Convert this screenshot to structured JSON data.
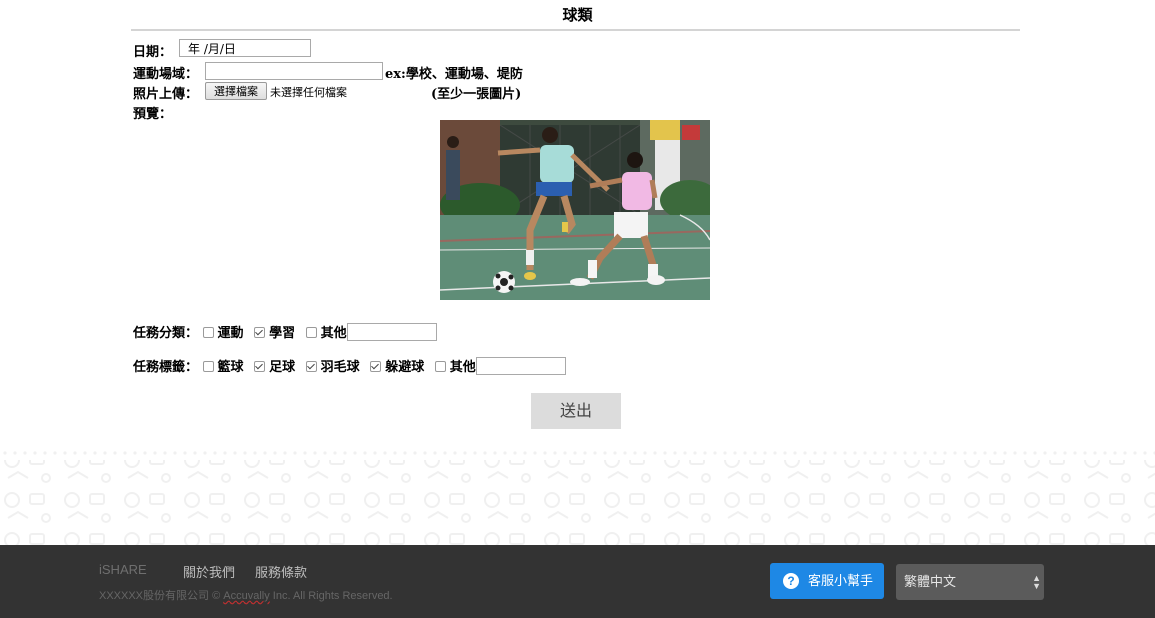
{
  "page": {
    "title": "球類"
  },
  "form": {
    "date_label": "日期：",
    "date_value": "年 /月/日",
    "venue_label": "運動場域：",
    "venue_value": "",
    "venue_hint": "ex:學校、運動場、堤防",
    "photo_label": "照片上傳：",
    "file_button": "選擇檔案",
    "file_status": "未選擇任何檔案",
    "photo_hint": "(至少一張圖片)",
    "preview_label": "預覽：",
    "category_label": "任務分類：",
    "categories": [
      {
        "label": "運動",
        "checked": false
      },
      {
        "label": "學習",
        "checked": true
      }
    ],
    "category_other_label": "其他",
    "category_other_value": "",
    "tag_label": "任務標籤：",
    "tags": [
      {
        "label": "籃球",
        "checked": false
      },
      {
        "label": "足球",
        "checked": true
      },
      {
        "label": "羽毛球",
        "checked": true
      },
      {
        "label": "躲避球",
        "checked": true
      }
    ],
    "tag_other_label": "其他",
    "tag_other_value": "",
    "submit": "送出"
  },
  "footer": {
    "brand": "iSHARE",
    "about": "關於我們",
    "terms": "服務條款",
    "copyright_prefix": "XXXXXX股份有限公司 © ",
    "copyright_brand": "Accuvally",
    "copyright_suffix": " Inc. All Rights Reserved.",
    "help_button": "客服小幫手",
    "help_icon_glyph": "?",
    "language": "繁體中文"
  },
  "colors": {
    "footer_bg": "#333333",
    "help_button": "#1e88e5",
    "submit_bg": "#dcdcdc"
  },
  "icons": [
    "question-circle-icon",
    "select-arrows-icon",
    "checkbox-icon"
  ]
}
